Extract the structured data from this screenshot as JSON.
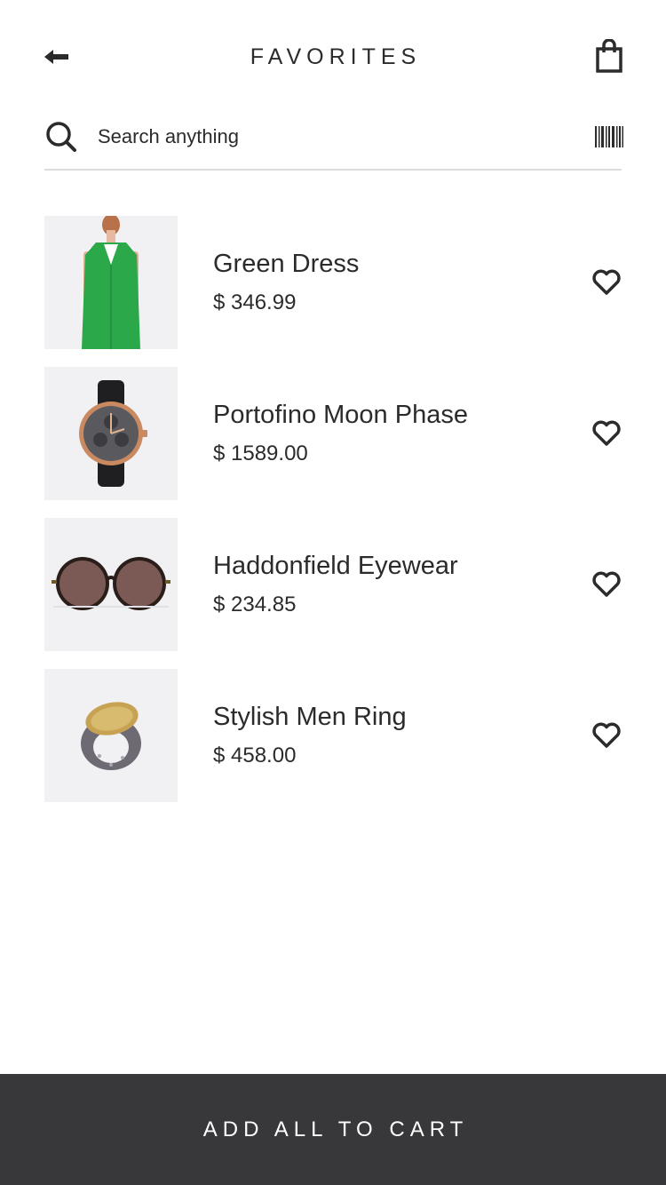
{
  "header": {
    "title": "FAVORITES",
    "back_icon": "arrow-left-icon",
    "bag_icon": "shopping-bag-icon"
  },
  "search": {
    "placeholder": "Search anything",
    "search_icon": "search-icon",
    "barcode_icon": "barcode-icon"
  },
  "favorites": [
    {
      "name": "Green Dress",
      "price": "$ 346.99",
      "image": "green-dress-image"
    },
    {
      "name": "Portofino Moon Phase",
      "price": "$ 1589.00",
      "image": "watch-image"
    },
    {
      "name": "Haddonfield Eyewear",
      "price": "$ 234.85",
      "image": "sunglasses-image"
    },
    {
      "name": "Stylish Men Ring",
      "price": "$ 458.00",
      "image": "ring-image"
    }
  ],
  "footer": {
    "cart_label": "ADD ALL TO CART"
  },
  "colors": {
    "text": "#2b2b2d",
    "thumb_bg": "#f1f1f3",
    "footer_bg": "#38383a",
    "divider": "#dcdcde"
  }
}
